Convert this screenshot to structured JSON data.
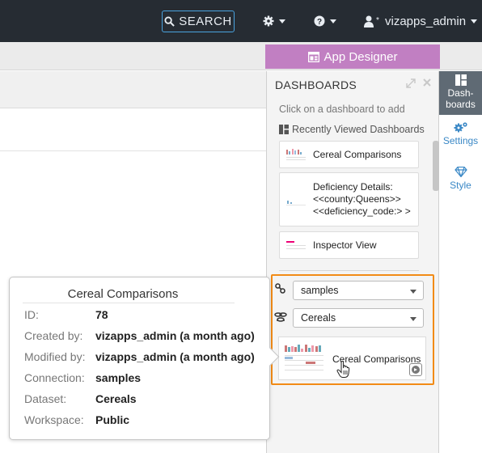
{
  "topnav": {
    "search_label": "SEARCH",
    "user_label": "vizapps_admin"
  },
  "app_designer_label": "App Designer",
  "panel": {
    "title": "DASHBOARDS",
    "hint": "Click on a dashboard to add",
    "recent_header": "Recently Viewed Dashboards",
    "recent": [
      {
        "label": "Cereal Comparisons"
      },
      {
        "label": "Deficiency Details: <<county:Queens>> <<deficiency_code:> >"
      },
      {
        "label": "Inspector View"
      }
    ],
    "connection_select": "samples",
    "dataset_select": "Cereals",
    "result_label": "Cereal Comparisons"
  },
  "side_tabs": {
    "dashboards": "Dash-\nboards",
    "dashboards_l1": "Dash-",
    "dashboards_l2": "boards",
    "settings": "Settings",
    "style": "Style"
  },
  "tooltip": {
    "title": "Cereal Comparisons",
    "rows": [
      {
        "key": "ID:",
        "value": "78"
      },
      {
        "key": "Created by:",
        "value": "vizapps_admin (a month ago)"
      },
      {
        "key": "Modified by:",
        "value": "vizapps_admin (a month ago)"
      },
      {
        "key": "Connection:",
        "value": "samples"
      },
      {
        "key": "Dataset:",
        "value": "Cereals"
      },
      {
        "key": "Workspace:",
        "value": "Public"
      }
    ]
  },
  "colors": {
    "topbar": "#262c33",
    "app_designer": "#c17fc2",
    "highlight": "#f28b16",
    "link": "#3a88c6"
  }
}
